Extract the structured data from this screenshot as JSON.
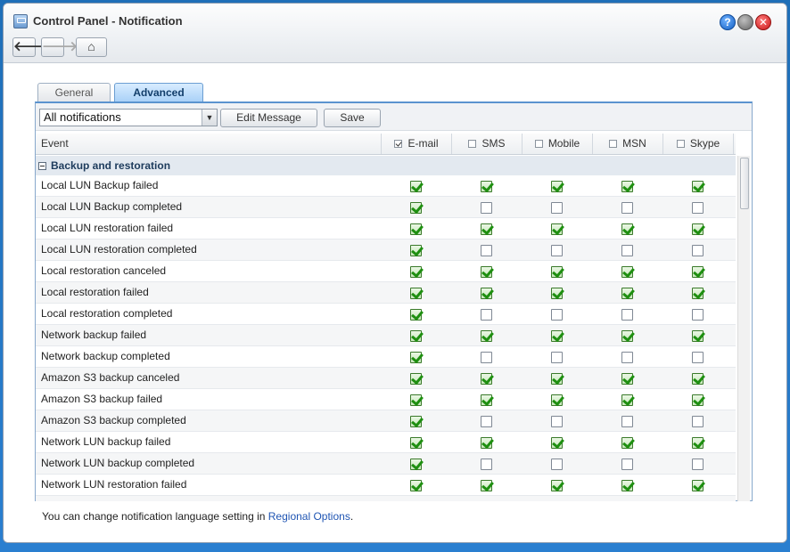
{
  "window": {
    "title": "Control Panel - Notification",
    "help_label": "?",
    "nav_back": "🡐",
    "nav_forward": "🡒",
    "nav_home": "⌂"
  },
  "tabs": [
    {
      "label": "General",
      "active": false
    },
    {
      "label": "Advanced",
      "active": true
    }
  ],
  "toolbar": {
    "filter_value": "All notifications",
    "edit_label": "Edit Message",
    "save_label": "Save"
  },
  "columns": [
    {
      "label": "Event",
      "checked": null
    },
    {
      "label": "E-mail",
      "checked": true
    },
    {
      "label": "SMS",
      "checked": false
    },
    {
      "label": "Mobile",
      "checked": false
    },
    {
      "label": "MSN",
      "checked": false
    },
    {
      "label": "Skype",
      "checked": false
    }
  ],
  "group": {
    "label": "Backup and restoration",
    "rows": [
      {
        "event": "Local LUN Backup failed",
        "checks": [
          true,
          true,
          true,
          true,
          true
        ]
      },
      {
        "event": "Local LUN Backup completed",
        "checks": [
          true,
          false,
          false,
          false,
          false
        ]
      },
      {
        "event": "Local LUN restoration failed",
        "checks": [
          true,
          true,
          true,
          true,
          true
        ]
      },
      {
        "event": "Local LUN restoration completed",
        "checks": [
          true,
          false,
          false,
          false,
          false
        ]
      },
      {
        "event": "Local restoration canceled",
        "checks": [
          true,
          true,
          true,
          true,
          true
        ]
      },
      {
        "event": "Local restoration failed",
        "checks": [
          true,
          true,
          true,
          true,
          true
        ]
      },
      {
        "event": "Local restoration completed",
        "checks": [
          true,
          false,
          false,
          false,
          false
        ]
      },
      {
        "event": "Network backup failed",
        "checks": [
          true,
          true,
          true,
          true,
          true
        ]
      },
      {
        "event": "Network backup completed",
        "checks": [
          true,
          false,
          false,
          false,
          false
        ]
      },
      {
        "event": "Amazon S3 backup canceled",
        "checks": [
          true,
          true,
          true,
          true,
          true
        ]
      },
      {
        "event": "Amazon S3 backup failed",
        "checks": [
          true,
          true,
          true,
          true,
          true
        ]
      },
      {
        "event": "Amazon S3 backup completed",
        "checks": [
          true,
          false,
          false,
          false,
          false
        ]
      },
      {
        "event": "Network LUN backup failed",
        "checks": [
          true,
          true,
          true,
          true,
          true
        ]
      },
      {
        "event": "Network LUN backup completed",
        "checks": [
          true,
          false,
          false,
          false,
          false
        ]
      },
      {
        "event": "Network LUN restoration failed",
        "checks": [
          true,
          true,
          true,
          true,
          true
        ]
      },
      {
        "event": "",
        "checks": [
          true,
          false,
          false,
          false,
          false
        ]
      }
    ]
  },
  "footer": {
    "text": "You can change notification language setting in ",
    "link": "Regional Options",
    "suffix": "."
  }
}
